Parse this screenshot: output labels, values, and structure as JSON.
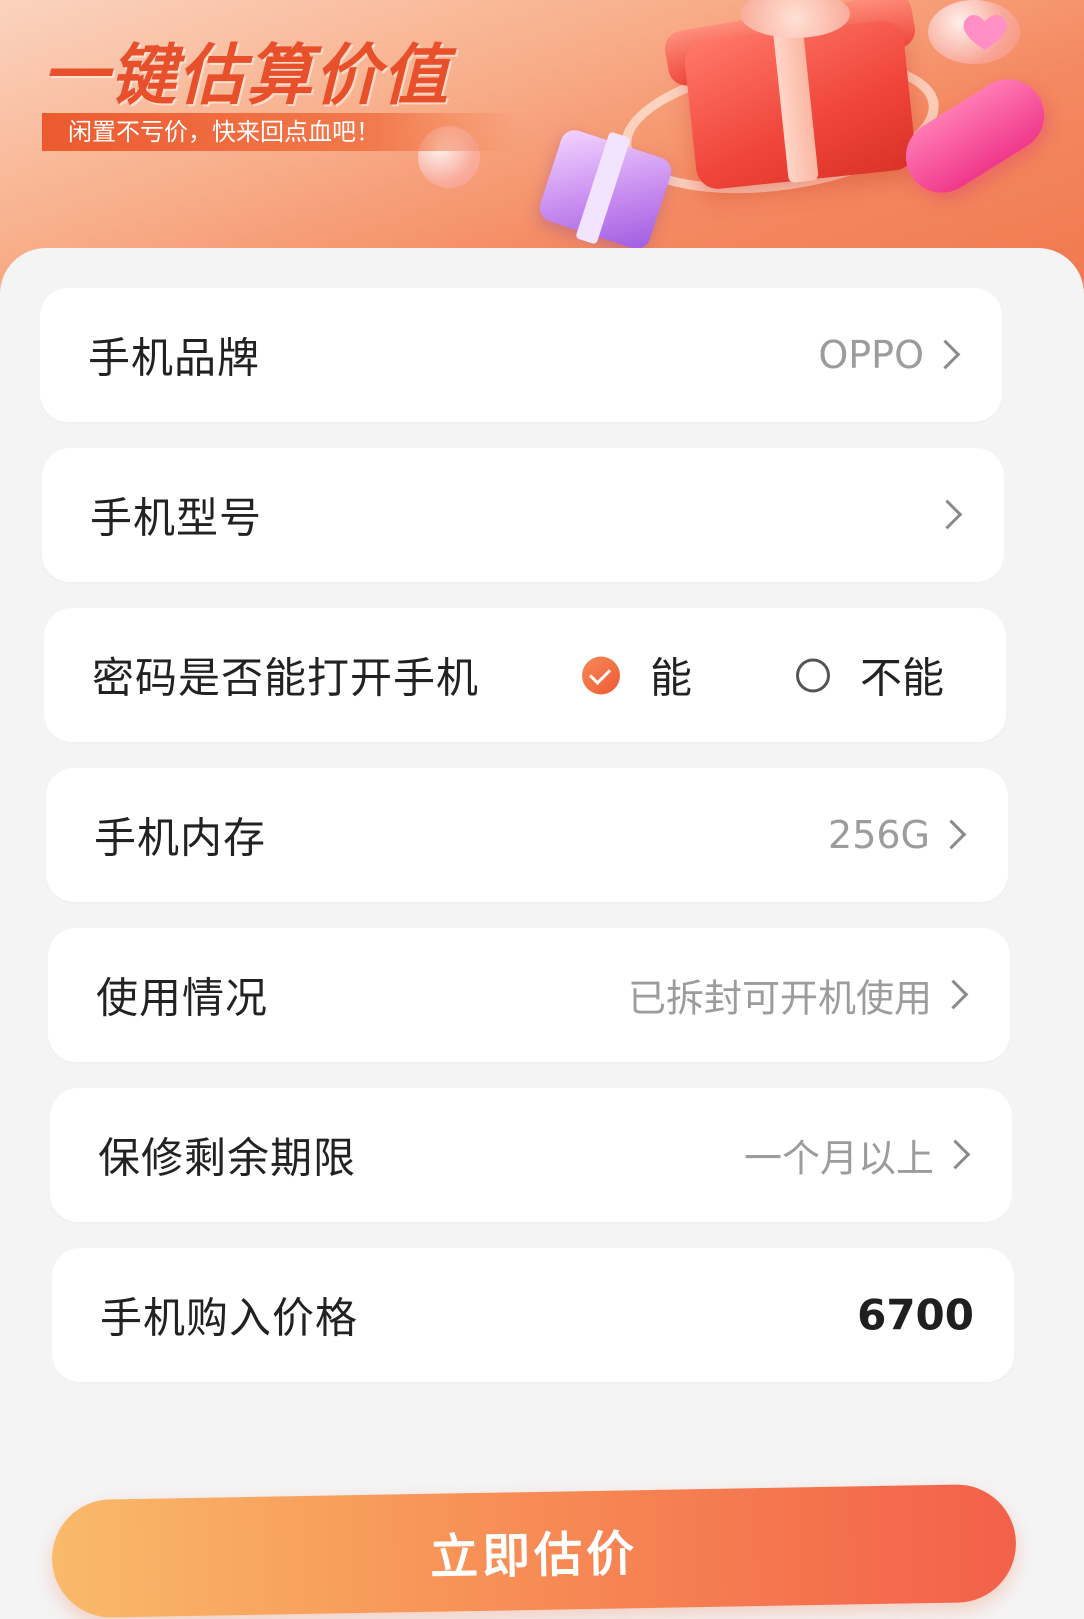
{
  "banner": {
    "title": "一键估算价值",
    "subtitle": "闲置不亏价，快来回点血吧！"
  },
  "form": {
    "brand": {
      "label": "手机品牌",
      "value": "OPPO"
    },
    "model": {
      "label": "手机型号",
      "value": ""
    },
    "unlock": {
      "label": "密码是否能打开手机",
      "options": [
        {
          "label": "能",
          "selected": true
        },
        {
          "label": "不能",
          "selected": false
        }
      ]
    },
    "storage": {
      "label": "手机内存",
      "value": "256G"
    },
    "condition": {
      "label": "使用情况",
      "value": "已拆封可开机使用"
    },
    "warranty": {
      "label": "保修剩余期限",
      "value": "一个月以上"
    },
    "purchase_price": {
      "label": "手机购入价格",
      "value": "6700"
    }
  },
  "cta": {
    "label": "立即估价"
  },
  "colors": {
    "accent": "#ef5a32",
    "title": "#e8502b",
    "muted_text": "#9c9c9c"
  },
  "icons": {
    "chevron": "chevron-right-icon",
    "checked": "check-circle-icon",
    "unchecked": "radio-empty-icon"
  }
}
